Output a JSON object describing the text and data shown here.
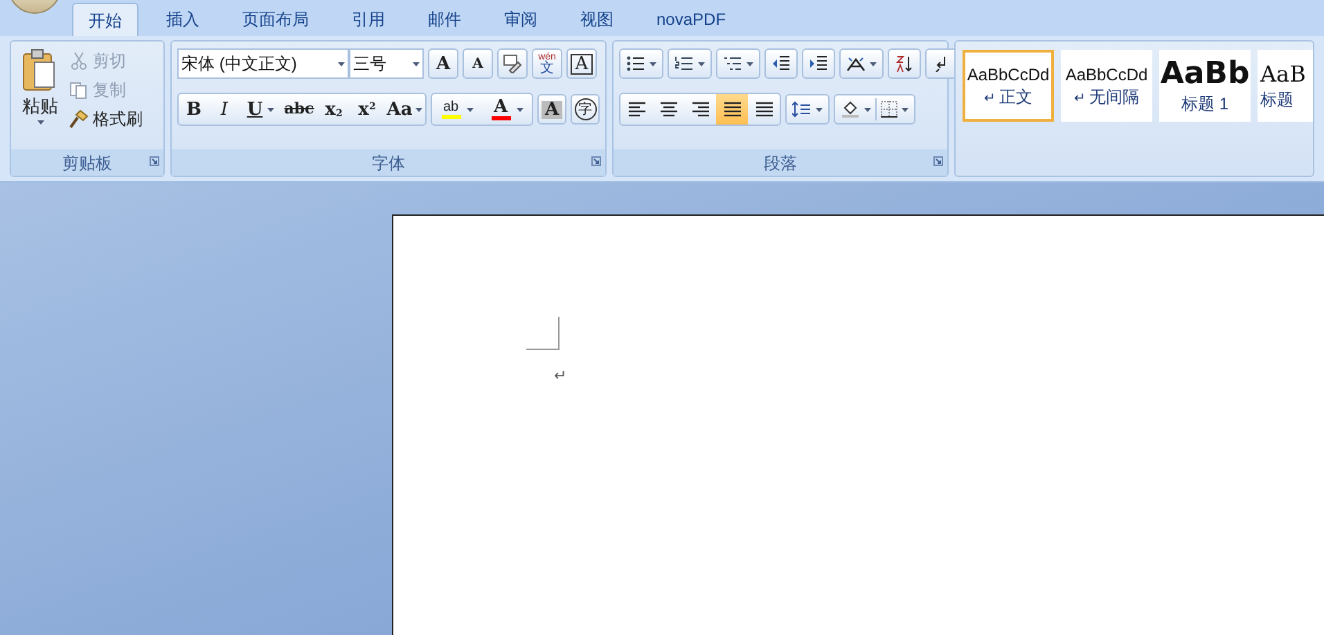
{
  "tabs": [
    {
      "label": "开始",
      "selected": true
    },
    {
      "label": "插入",
      "selected": false
    },
    {
      "label": "页面布局",
      "selected": false
    },
    {
      "label": "引用",
      "selected": false
    },
    {
      "label": "邮件",
      "selected": false
    },
    {
      "label": "审阅",
      "selected": false
    },
    {
      "label": "视图",
      "selected": false
    },
    {
      "label": "novaPDF",
      "selected": false
    }
  ],
  "clipboard": {
    "paste": "粘贴",
    "items": [
      {
        "kind": "cut",
        "label": "剪切",
        "disabled": true
      },
      {
        "kind": "copy",
        "label": "复制",
        "disabled": true
      },
      {
        "kind": "painter",
        "label": "格式刷",
        "disabled": false
      }
    ],
    "group_label": "剪贴板"
  },
  "font": {
    "font_name": "宋体 (中文正文)",
    "font_size": "三号",
    "row1": [
      {
        "kind": "grow",
        "text": "A"
      },
      {
        "kind": "shrink",
        "text": "A"
      },
      {
        "kind": "clear"
      },
      {
        "kind": "phonetic",
        "text": "文",
        "ruby": "wén"
      },
      {
        "kind": "border",
        "text": "A"
      }
    ],
    "row2": [
      {
        "kind": "bold",
        "text": "B"
      },
      {
        "kind": "italic",
        "text": "I"
      },
      {
        "kind": "underline",
        "text": "U"
      },
      {
        "kind": "strike",
        "text": "abc"
      },
      {
        "kind": "sub",
        "text": "x",
        "script": "2"
      },
      {
        "kind": "sup",
        "text": "x",
        "script": "2"
      },
      {
        "kind": "case",
        "text": "Aa"
      },
      {
        "kind": "highlight",
        "text": "ab",
        "color": "#ffff00"
      },
      {
        "kind": "color",
        "text": "A",
        "color": "#ff0000"
      },
      {
        "kind": "shade",
        "text": "A"
      },
      {
        "kind": "enclose",
        "text": "字"
      }
    ],
    "group_label": "字体"
  },
  "paragraph": {
    "row1": [
      {
        "kind": "bullets"
      },
      {
        "kind": "numbering"
      },
      {
        "kind": "multilevel"
      },
      {
        "kind": "decrease-indent"
      },
      {
        "kind": "increase-indent"
      },
      {
        "kind": "asian-layout"
      },
      {
        "kind": "sort"
      },
      {
        "kind": "show-marks"
      }
    ],
    "row2": [
      {
        "kind": "align-left",
        "selected": false
      },
      {
        "kind": "align-center",
        "selected": false
      },
      {
        "kind": "align-right",
        "selected": false
      },
      {
        "kind": "justify",
        "selected": true
      },
      {
        "kind": "distributed",
        "selected": false
      }
    ],
    "group_label": "段落"
  },
  "styles": [
    {
      "kind": "normal",
      "preview": "AaBbCcDd",
      "mark": "↵",
      "label": "正文",
      "selected": true
    },
    {
      "kind": "no-spacing",
      "preview": "AaBbCcDd",
      "mark": "↵",
      "label": "无间隔",
      "selected": false
    },
    {
      "kind": "heading1",
      "preview": "AaBb",
      "label": "标题 1",
      "selected": false
    },
    {
      "kind": "title",
      "preview": "AaB",
      "label": "标题",
      "selected": false
    }
  ],
  "document": {
    "paragraph_mark": "↵"
  }
}
